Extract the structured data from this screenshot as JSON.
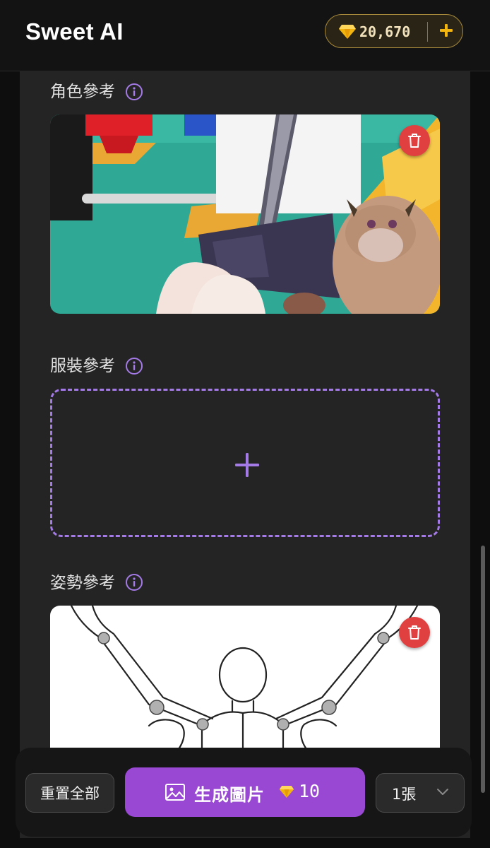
{
  "header": {
    "app_title": "Sweet AI",
    "credits": {
      "amount": "20,670",
      "gem_icon": "diamond-icon",
      "add_icon": "plus-icon"
    }
  },
  "sections": {
    "character": {
      "label": "角色參考",
      "info_icon": "info-icon",
      "has_image": true,
      "image_desc_icon": "photo-thumbnail"
    },
    "outfit": {
      "label": "服裝參考",
      "info_icon": "info-icon",
      "has_image": false
    },
    "pose": {
      "label": "姿勢參考",
      "info_icon": "info-icon",
      "has_image": true
    }
  },
  "actions": {
    "reset_label": "重置全部",
    "generate_label": "生成圖片",
    "generate_cost": "10",
    "count_value": "1張"
  },
  "colors": {
    "accent_purple": "#9848d2",
    "dashed_border": "#a47ae6",
    "delete_red": "#e14040",
    "gold": "#f2b40f"
  }
}
